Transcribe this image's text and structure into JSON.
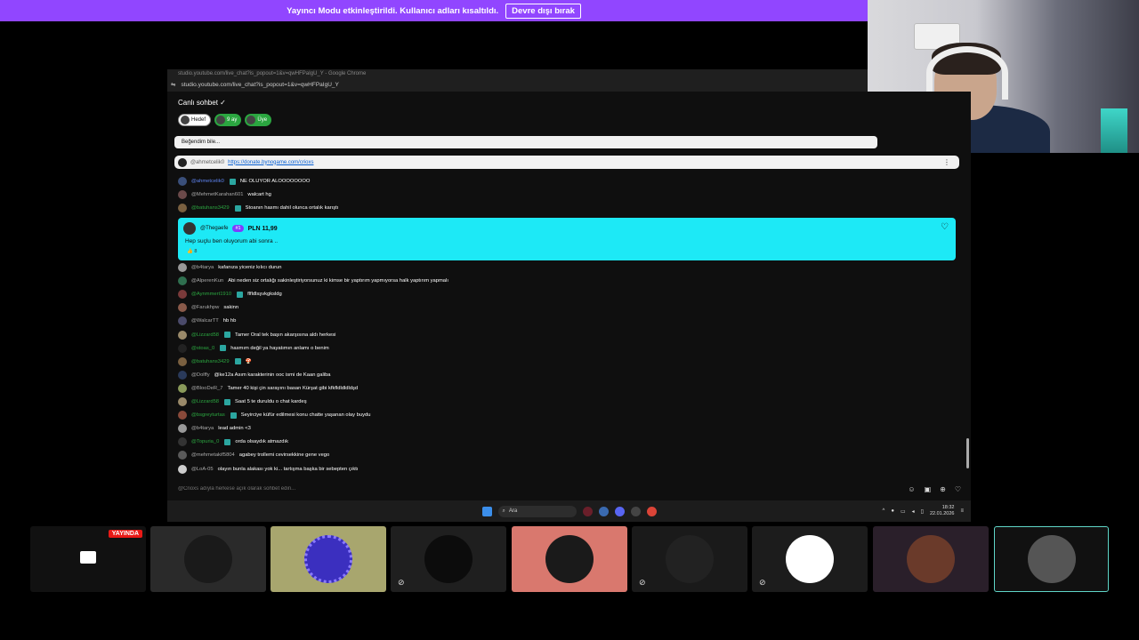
{
  "banner": {
    "message": "Yayıncı Modu etkinleştirildi. Kullanıcı adları kısaltıldı.",
    "button": "Devre dışı bırak"
  },
  "browser": {
    "title": "studio.youtube.com/live_chat?is_popout=1&v=qwHFPaIgU_Y - Google Chrome",
    "url": "studio.youtube.com/live_chat?is_popout=1&v=qwHFPaIgU_Y"
  },
  "chat": {
    "title": "Canlı sohbet ✓",
    "chips": [
      "Hedef",
      "9 ay",
      "Üye"
    ],
    "pinned": "Beğendim bile...",
    "donation": {
      "user": "@ahmetcelik0",
      "link": "https://donate.bynogame.com/crioxs"
    },
    "messages": [
      {
        "user": "@ahmetcelik0",
        "style": "blue",
        "text": "NE OLUYOR ALOOOOOOOO",
        "avatar": "#3a4f7a"
      },
      {
        "user": "@MehmetKarahan601",
        "style": "gray",
        "text": "walcart hg",
        "avatar": "#6b4a4a"
      },
      {
        "user": "@batuhans3429",
        "style": "green",
        "text": "Stoanın hasmı dahil olunca ortalık karıştı",
        "avatar": "#7a6040"
      }
    ],
    "superchat": {
      "user": "@Thegaefe",
      "rank": "#1",
      "amount": "PLN 11,99",
      "text": "Hep suçlu ben oluyorum abi sonra ..",
      "likes": "8"
    },
    "messages2": [
      {
        "user": "@b4tarya",
        "style": "gray",
        "text": "kafanıza yiceniz kılıcı durun",
        "avatar": "#999"
      },
      {
        "user": "@AlperenKun",
        "style": "gray",
        "text": "Abi neden siz ortalığı sakinleştiriyorsunuz ki kimse bir yaptırım yapmıyorsa halk yaptırım yapmalı",
        "avatar": "#2f6f4f"
      },
      {
        "user": "@Aynmmert1910",
        "style": "green",
        "text": "flfldlsşvkgksldg",
        "avatar": "#7a3a3a"
      },
      {
        "user": "@Farukhpw",
        "style": "gray",
        "text": "sakinn",
        "avatar": "#8a5a4a"
      },
      {
        "user": "@WalcarTT",
        "style": "gray",
        "text": "hb hb",
        "avatar": "#4a4a6a"
      },
      {
        "user": "@Lizzard58",
        "style": "green",
        "text": "Tamer Oral tek başın akarşısına aldı herkesi",
        "avatar": "#9a8a6a"
      },
      {
        "user": "@stoas_0",
        "style": "green",
        "text": "hasmım değil ya hayatımın anlamı o benim",
        "avatar": "#222"
      },
      {
        "user": "@batuhans3429",
        "style": "green",
        "text": "🍄",
        "avatar": "#7a6040"
      },
      {
        "user": "@Dolffy",
        "style": "gray",
        "text": "@ke12a Asım karakterinin ooc ismi de Kaan galiba",
        "avatar": "#2a3a5a"
      },
      {
        "user": "@BlooDeR_7",
        "style": "gray",
        "text": "Tamer 40 kişi çin sarayını basan Kürşat gibi kfkfldldldldşd",
        "avatar": "#8a9a5a"
      },
      {
        "user": "@Lizzard58",
        "style": "green",
        "text": "Saat 5 te duruldu o chat kardeş",
        "avatar": "#9a8a6a"
      },
      {
        "user": "@bsgreyturtas",
        "style": "green",
        "text": "Seyirciye küfür edilmesi konu chatte yaşanan olay buydu",
        "avatar": "#8a4a3a"
      },
      {
        "user": "@b4tarya",
        "style": "gray",
        "text": "lead admin <3",
        "avatar": "#999"
      },
      {
        "user": "@Topuria_0",
        "style": "green",
        "text": "orda olsaydık atmazdık",
        "avatar": "#333"
      },
      {
        "user": "@mehmetakif5804",
        "style": "gray",
        "text": "agabey trollemi cevirsekkine gene vego",
        "avatar": "#5a5a5a"
      },
      {
        "user": "@LoA-05",
        "style": "gray",
        "text": "olayın bunla alakası yok ki... tartışma başka bir sebepten çıktı",
        "avatar": "#ccc"
      }
    ],
    "input_placeholder": "@Crioxs adıyla herkese açık olarak sohbet edin..."
  },
  "taskbar": {
    "search": "Ara",
    "time": "18:32",
    "date": "22.01.2026"
  },
  "tiles": {
    "live_label": "YAYINDA"
  }
}
